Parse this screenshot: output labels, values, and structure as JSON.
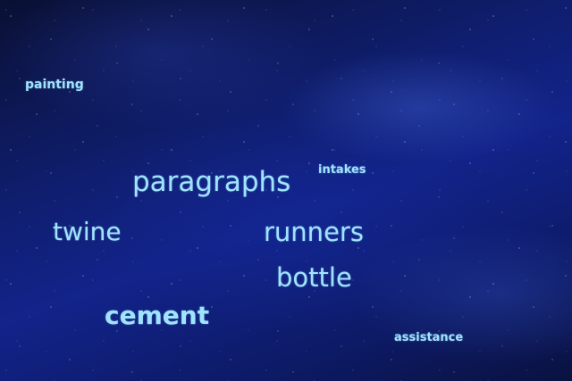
{
  "words": {
    "painting": "painting",
    "intakes": "intakes",
    "paragraphs": "paragraphs",
    "twine": "twine",
    "runners": "runners",
    "bottle": "bottle",
    "cement": "cement",
    "assistance": "assistance"
  },
  "colors": {
    "text": "#9fe4ff",
    "background": "#12238a"
  }
}
